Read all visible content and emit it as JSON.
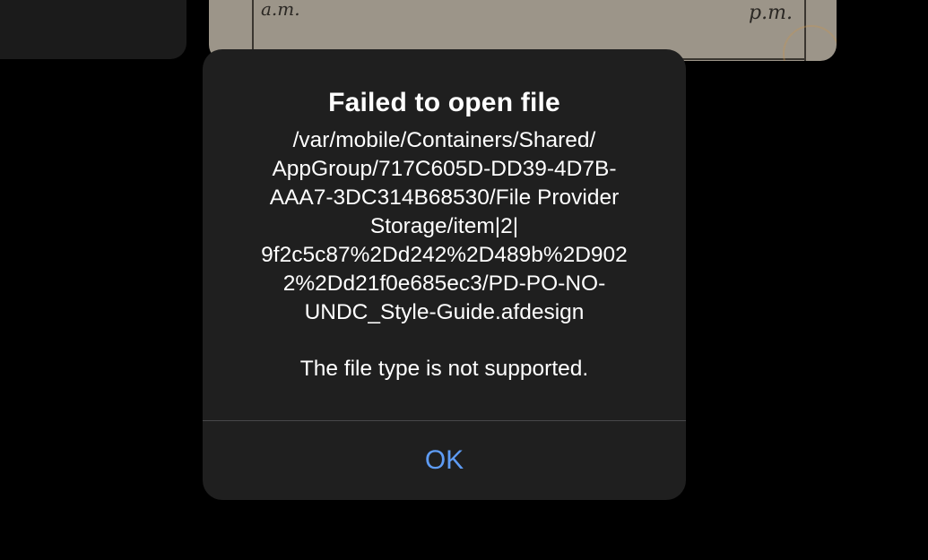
{
  "background": {
    "document_note_left": "a.m.",
    "document_note_right": "p.m."
  },
  "alert": {
    "title": "Failed to open file",
    "path_lines": [
      "/var/mobile/Containers/Shared/",
      "AppGroup/717C605D-DD39-4D7B-",
      "AAA7-3DC314B68530/File Provider",
      "Storage/item|2|",
      "9f2c5c87%2Dd242%2D489b%2D902",
      "2%2Dd21f0e685ec3/PD-PO-NO-",
      "UNDC_Style-Guide.afdesign"
    ],
    "detail": "The file type is not supported.",
    "ok_label": "OK"
  },
  "colors": {
    "backdrop": "#000000",
    "alert_background": "#1f1f1f",
    "text": "#ffffff",
    "accent": "#5e9cf5",
    "divider": "#48484a"
  }
}
